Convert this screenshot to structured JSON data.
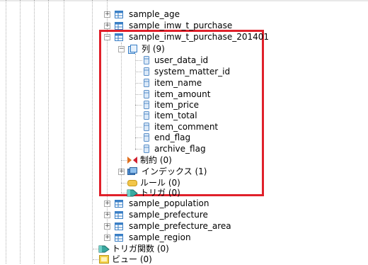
{
  "tree": {
    "items": [
      {
        "label": "sample_age",
        "icon": "table-icon"
      },
      {
        "label": "sample_imw_t_purchase",
        "icon": "table-icon"
      },
      {
        "label": "sample_imw_t_purchase_201401",
        "icon": "table-icon",
        "expanded": true
      },
      {
        "label": "列 (9)",
        "icon": "columns-folder-icon",
        "expanded": true
      },
      {
        "label": "user_data_id",
        "icon": "column-icon"
      },
      {
        "label": "system_matter_id",
        "icon": "column-icon"
      },
      {
        "label": "item_name",
        "icon": "column-icon"
      },
      {
        "label": "item_amount",
        "icon": "column-icon"
      },
      {
        "label": "item_price",
        "icon": "column-icon"
      },
      {
        "label": "item_total",
        "icon": "column-icon"
      },
      {
        "label": "item_comment",
        "icon": "column-icon"
      },
      {
        "label": "end_flag",
        "icon": "column-icon"
      },
      {
        "label": "archive_flag",
        "icon": "column-icon"
      },
      {
        "label": "制約 (0)",
        "icon": "constraint-icon"
      },
      {
        "label": "インデックス (1)",
        "icon": "index-icon"
      },
      {
        "label": "ルール (0)",
        "icon": "rule-icon"
      },
      {
        "label": "トリガ (0)",
        "icon": "trigger-icon"
      },
      {
        "label": "sample_population",
        "icon": "table-icon"
      },
      {
        "label": "sample_prefecture",
        "icon": "table-icon"
      },
      {
        "label": "sample_prefecture_area",
        "icon": "table-icon"
      },
      {
        "label": "sample_region",
        "icon": "table-icon"
      },
      {
        "label": "トリガ関数 (0)",
        "icon": "trigger-function-icon"
      },
      {
        "label": "ビュー (0)",
        "icon": "view-icon"
      }
    ]
  },
  "colors": {
    "highlight_border": "#e0202a",
    "tree_lines": "#b0b0b0",
    "table_icon": "#3a7fc6",
    "column_icon": "#5a8fc8"
  }
}
